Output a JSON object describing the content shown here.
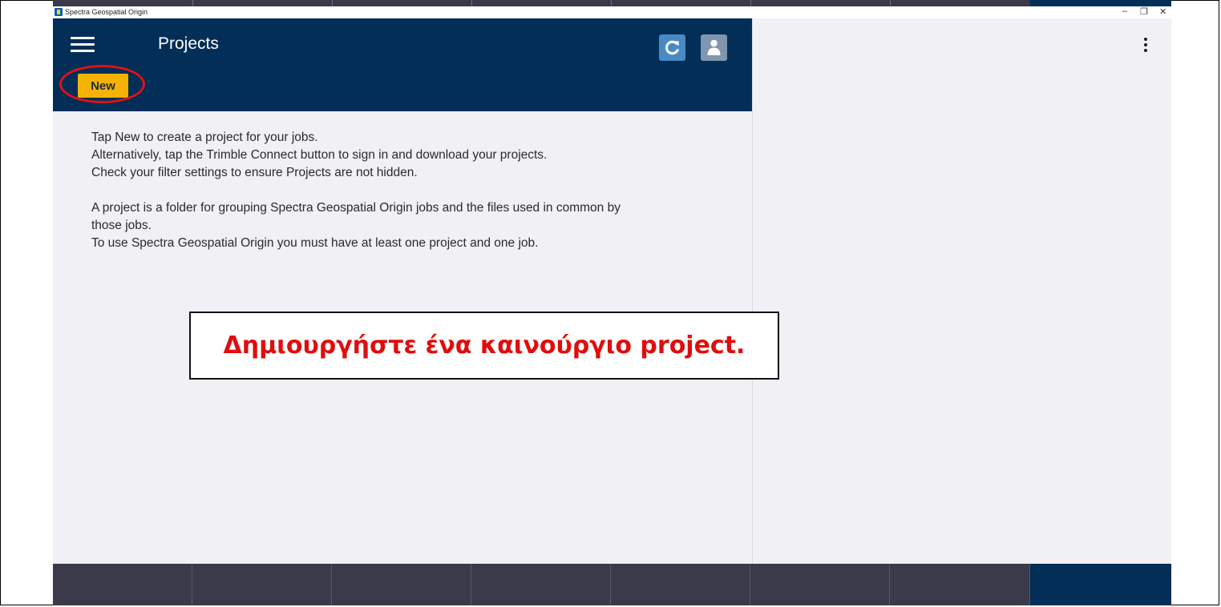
{
  "window": {
    "title": "Spectra Geospatial Origin",
    "minimize_glyph": "–",
    "restore_glyph": "❐",
    "close_glyph": "✕"
  },
  "header": {
    "title": "Projects",
    "new_label": "New",
    "refresh_icon": "refresh-icon",
    "user_icon": "user-icon",
    "menu_icon": "hamburger-icon"
  },
  "content": {
    "lines": [
      "Tap New to create a project for your jobs.",
      "Alternatively, tap the Trimble Connect button to sign in and download your projects.",
      "Check your filter settings to ensure Projects are not hidden.",
      "A project is a folder for grouping Spectra Geospatial Origin jobs and the files used in common by",
      "those jobs.",
      "To use Spectra Geospatial Origin you must have at least one project and one job."
    ]
  },
  "annotation": {
    "text": "Δημιουργήστε ένα καινούργιο project.",
    "color": "#e00d0d",
    "highlight_color": "#e01218"
  },
  "colors": {
    "header_bg": "#022e57",
    "new_button_bg": "#f5b301",
    "pane_bg": "#f1f0f5",
    "bottom_bar_bg": "#3a3a4a"
  }
}
